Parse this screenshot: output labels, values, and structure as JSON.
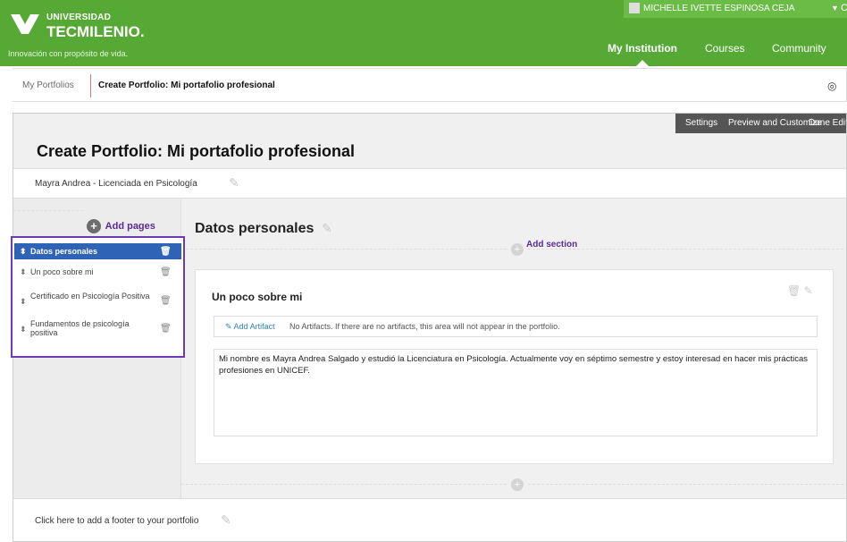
{
  "brand": {
    "university_small": "UNIVERSIDAD",
    "university_big": "TECMILENIO.",
    "tagline": "Innovación con propósito de vida."
  },
  "user": {
    "name": "MICHELLE IVETTE ESPINOSA CEJA",
    "menu_arrow": "▼",
    "extra": "C"
  },
  "nav": {
    "items": [
      {
        "label": "My Institution"
      },
      {
        "label": "Courses"
      },
      {
        "label": "Community"
      }
    ]
  },
  "breadcrumbs": {
    "root": "My Portfolios",
    "current": "Create Portfolio: Mi portafolio profesional"
  },
  "toolbar": {
    "settings": "Settings",
    "preview": "Preview and Customize",
    "done": "Done Editing"
  },
  "portfolio": {
    "title": "Create Portfolio: Mi portafolio profesional",
    "subtitle": "Mayra Andrea - Licenciada en Psicología"
  },
  "sidebar": {
    "add_pages": "Add pages",
    "pages": [
      {
        "label": "Datos personales",
        "active": true
      },
      {
        "label": "Un poco sobre mi",
        "active": false
      },
      {
        "label": "Certificado en Psicología Positiva",
        "active": false
      },
      {
        "label": "Fundamentos de psicología positiva",
        "active": false
      }
    ]
  },
  "main": {
    "page_title": "Datos personales",
    "add_section": "Add section",
    "section": {
      "title": "Un poco sobre mi",
      "add_artifact": "Add Artifact",
      "artifact_message": "No Artifacts. If there are no artifacts, this area will not appear in the portfolio.",
      "body": "Mi nombre es Mayra Andrea Salgado y estudió la Licenciatura en Psicología. Actualmente voy en séptimo semestre y estoy interesad en hacer mis prácticas profesiones en UNICEF."
    }
  },
  "footer": {
    "placeholder": "Click here to add a footer to your portfolio"
  },
  "icons": {
    "edit": "pencil-icon",
    "delete": "trash-icon",
    "drag": "drag-handle-icon",
    "add": "plus-circle-icon"
  },
  "colors": {
    "header_green": "#56a934",
    "active_blue": "#2f63b6",
    "purple_accent": "#6f3ab3"
  }
}
